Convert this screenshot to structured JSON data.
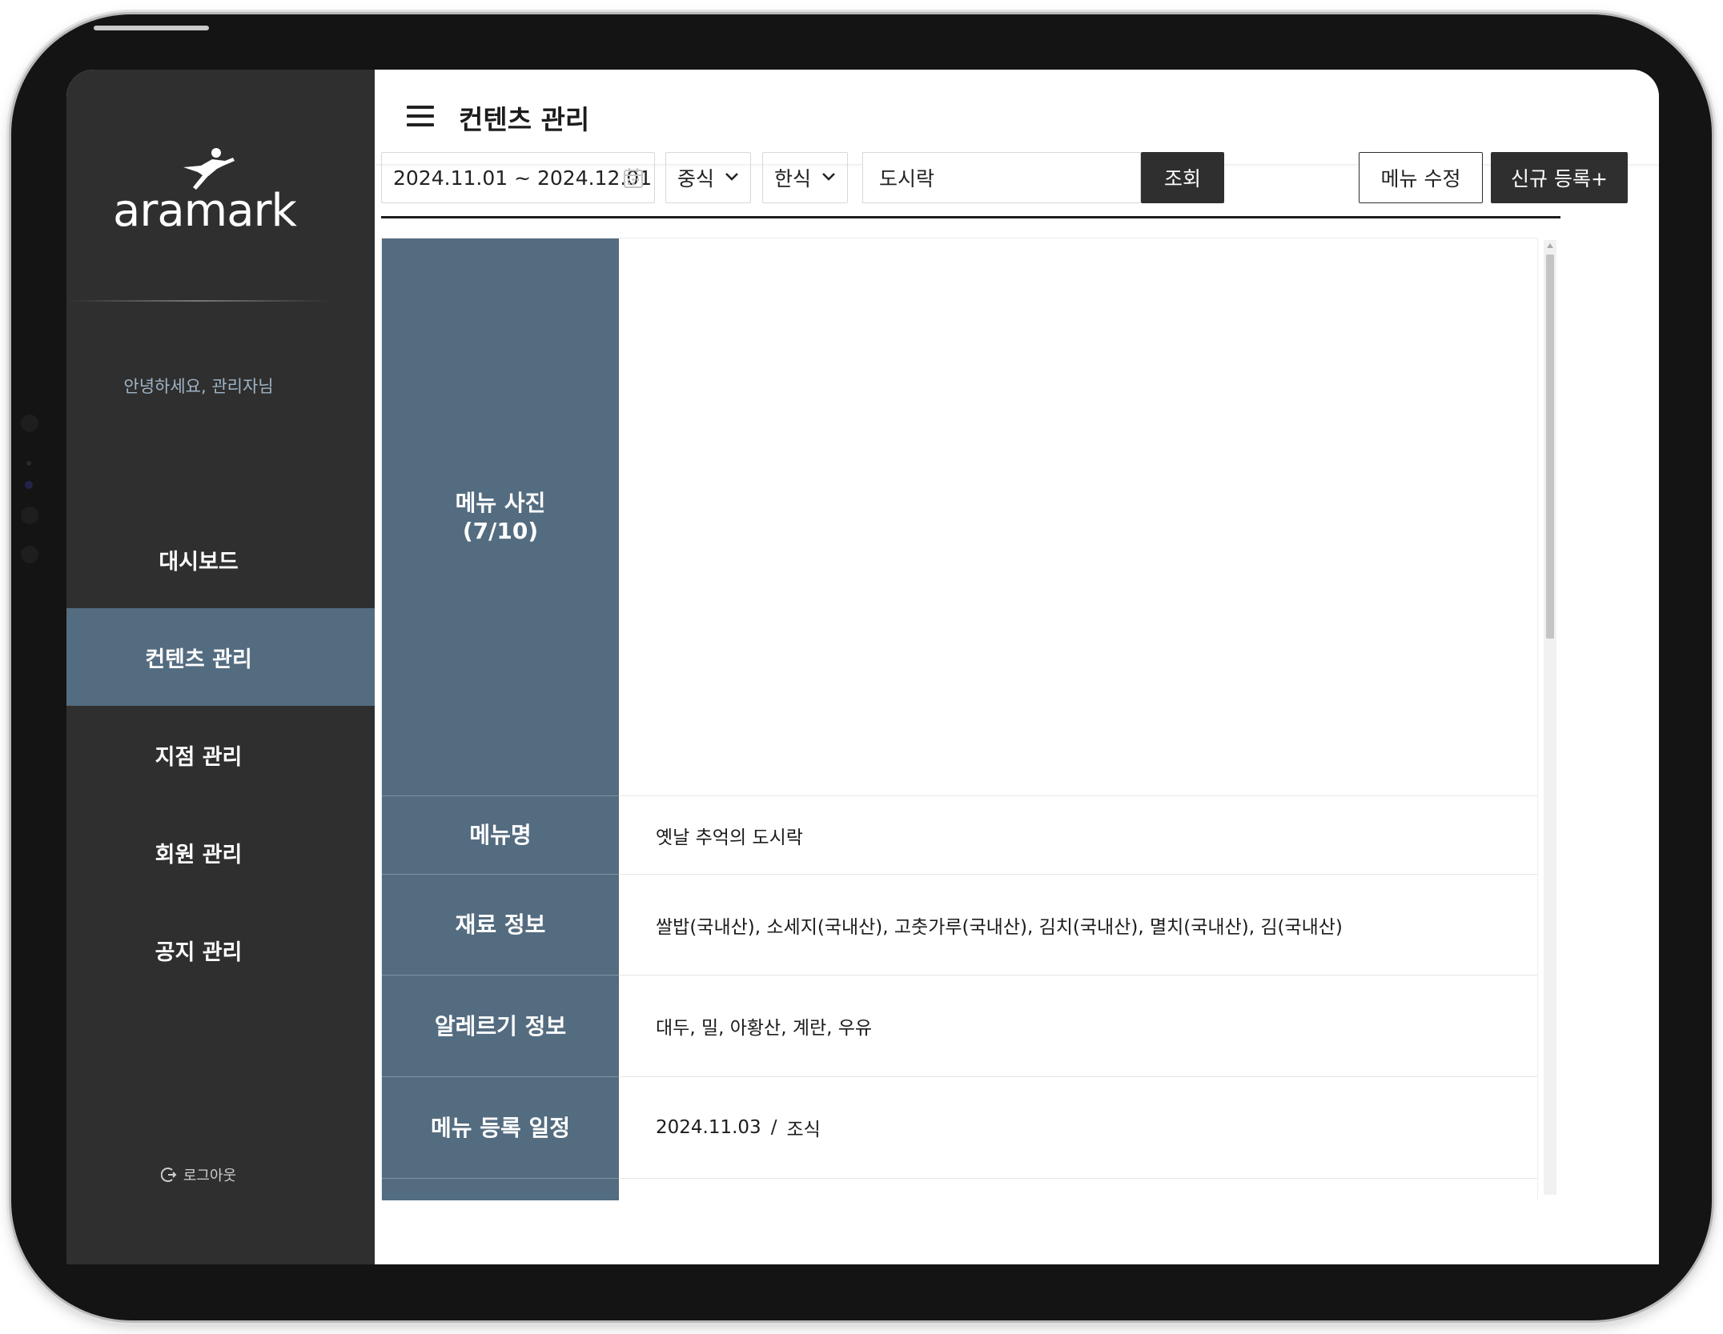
{
  "brand": {
    "logo_text": "aramark"
  },
  "sidebar": {
    "greeting": "안녕하세요, 관리자님",
    "items": [
      {
        "label": "대시보드",
        "active": false
      },
      {
        "label": "컨텐츠 관리",
        "active": true
      },
      {
        "label": "지점 관리",
        "active": false
      },
      {
        "label": "회원 관리",
        "active": false
      },
      {
        "label": "공지 관리",
        "active": false
      }
    ],
    "logout_label": "로그아웃"
  },
  "header": {
    "title": "컨텐츠 관리"
  },
  "filters": {
    "date_range": "2024.11.01 ~ 2024.12.01",
    "meal_select": "중식",
    "cuisine_select": "한식",
    "search_value": "도시락",
    "search_button": "조회",
    "edit_button": "메뉴 수정",
    "new_button": "신규 등록+"
  },
  "detail": {
    "photo_label": "메뉴 사진",
    "photo_count": "(7/10)",
    "menu_name_label": "메뉴명",
    "menu_name": "옛날 추억의 도시락",
    "ingredients_label": "재료 정보",
    "ingredients": "쌀밥(국내산), 소세지(국내산), 고춧가루(국내산), 김치(국내산), 멸치(국내산), 김(국내산)",
    "allergy_label": "알레르기 정보",
    "allergy": "대두, 밀, 아황산, 계란, 우유",
    "schedule_label": "메뉴 등록 일정",
    "schedule_date": "2024.11.03",
    "schedule_sep": "/",
    "schedule_meal": "조식"
  },
  "colors": {
    "sidebar_bg": "#2f2f2f",
    "accent": "#546c80",
    "dark_button": "#2f2f2f"
  }
}
